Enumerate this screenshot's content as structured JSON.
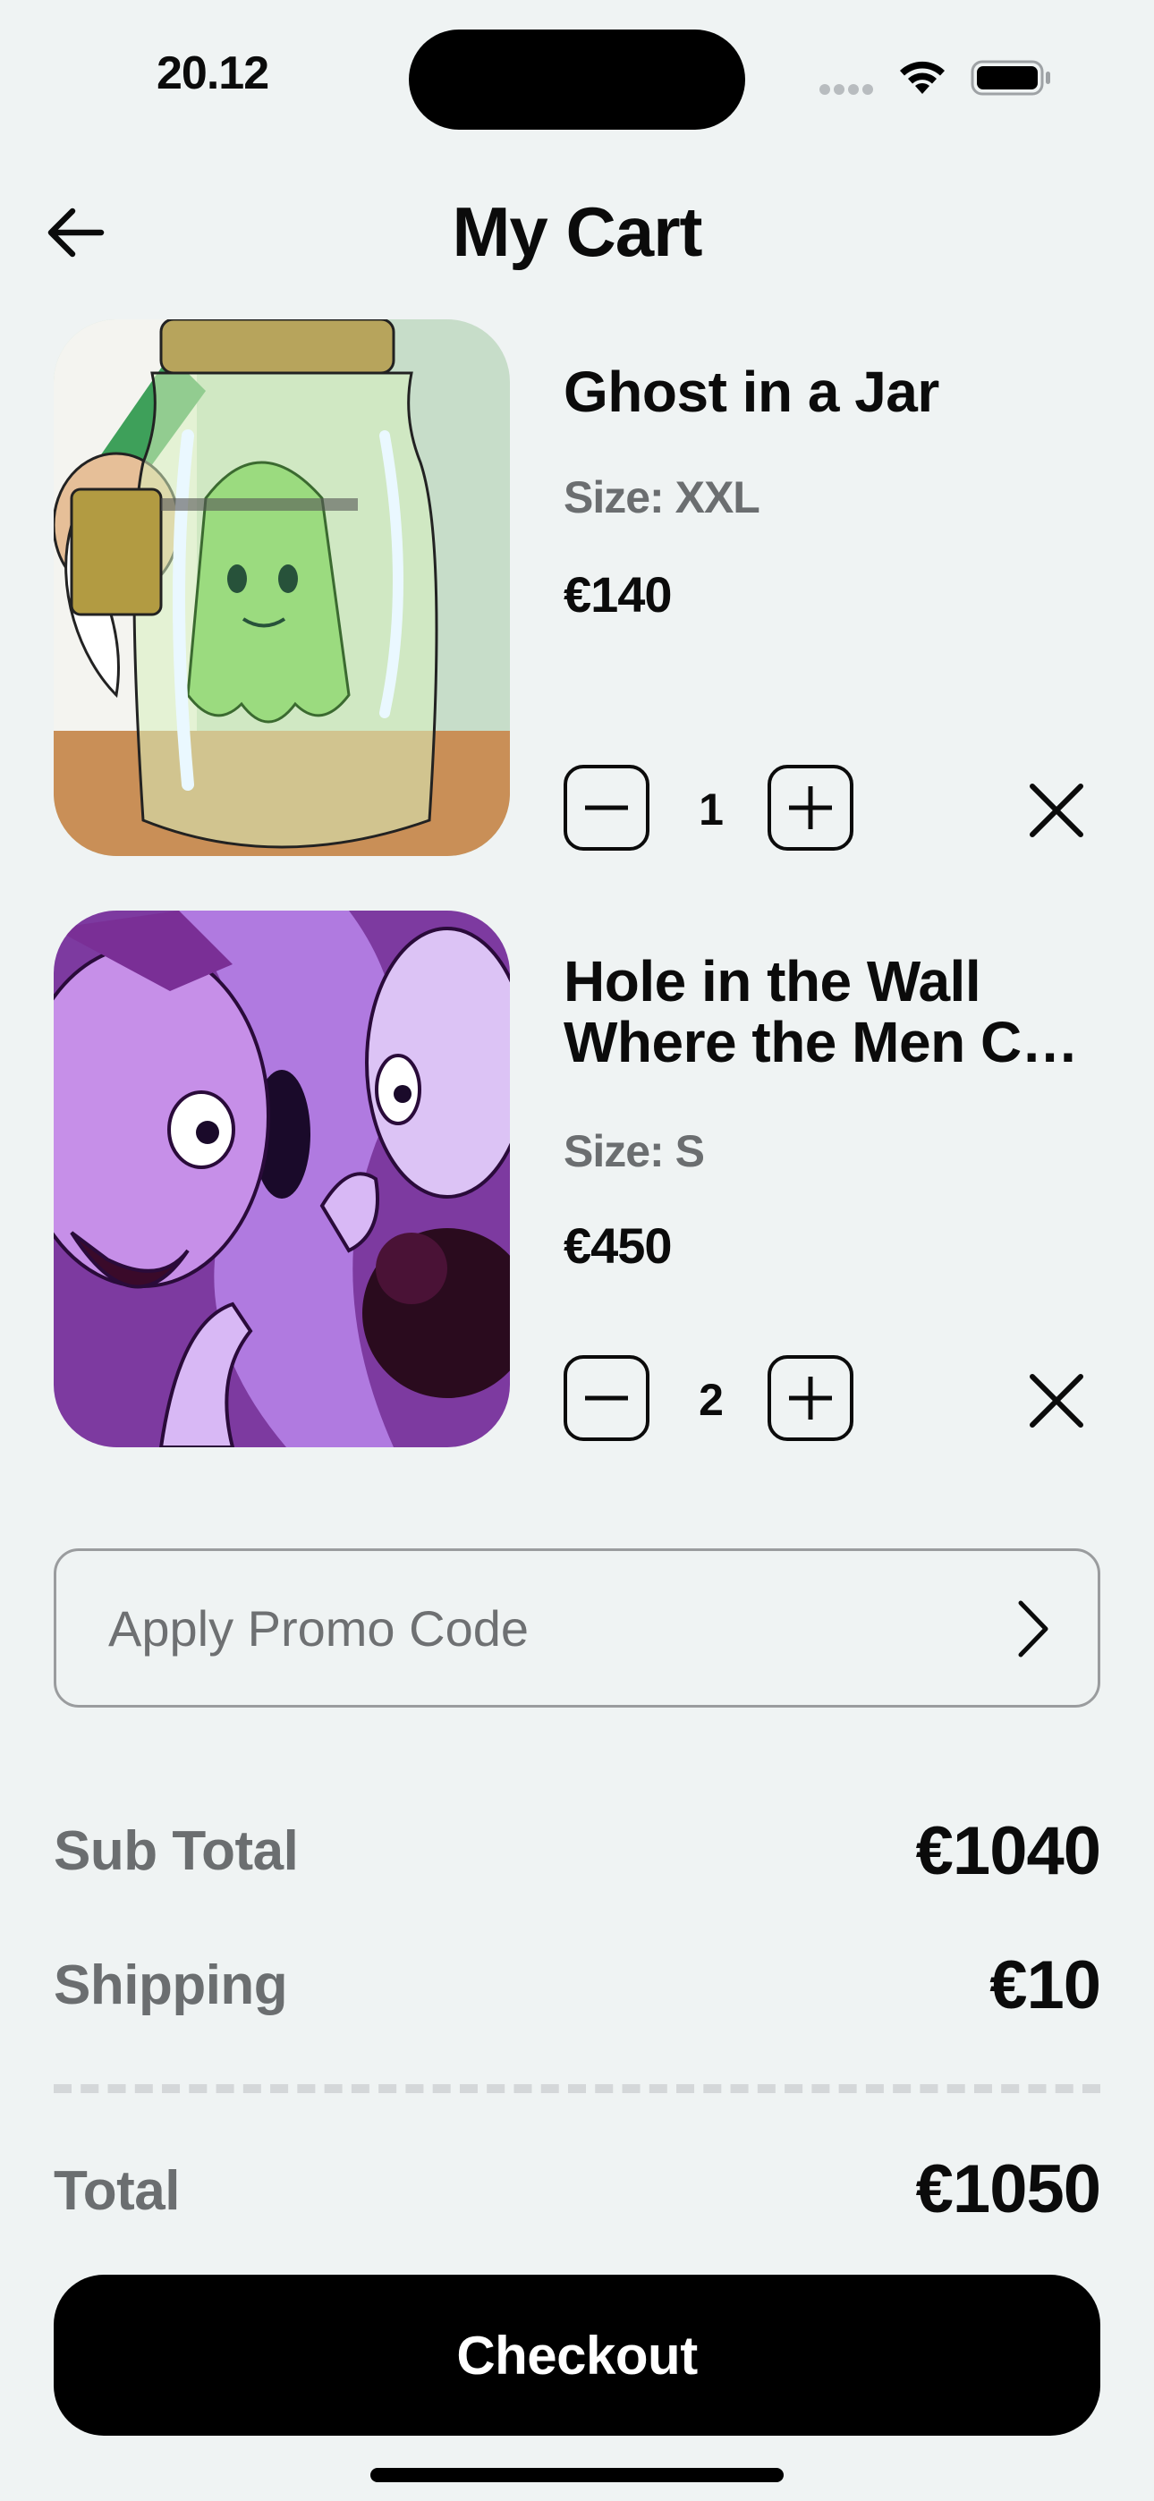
{
  "status_bar": {
    "time": "20.12"
  },
  "header": {
    "title": "My Cart",
    "back_icon": "arrow-left-icon"
  },
  "cart": {
    "items": [
      {
        "name": "Ghost in a Jar",
        "size": "Size: XXL",
        "price": "€140",
        "quantity": "1"
      },
      {
        "name_line1": "Hole in the Wall",
        "name_line2": "Where the Men Can See It All",
        "size": "Size: S",
        "price": "€450",
        "quantity": "2"
      }
    ]
  },
  "promo": {
    "placeholder": "Apply Promo Code"
  },
  "summary": {
    "subtotal_label": "Sub Total",
    "subtotal_value": "€1040",
    "shipping_label": "Shipping",
    "shipping_value": "€10",
    "total_label": "Total",
    "total_value": "€1050"
  },
  "checkout": {
    "label": "Checkout"
  },
  "colors": {
    "background": "#eff3f3",
    "primary": "#000000",
    "muted_text": "#6b6e70"
  }
}
